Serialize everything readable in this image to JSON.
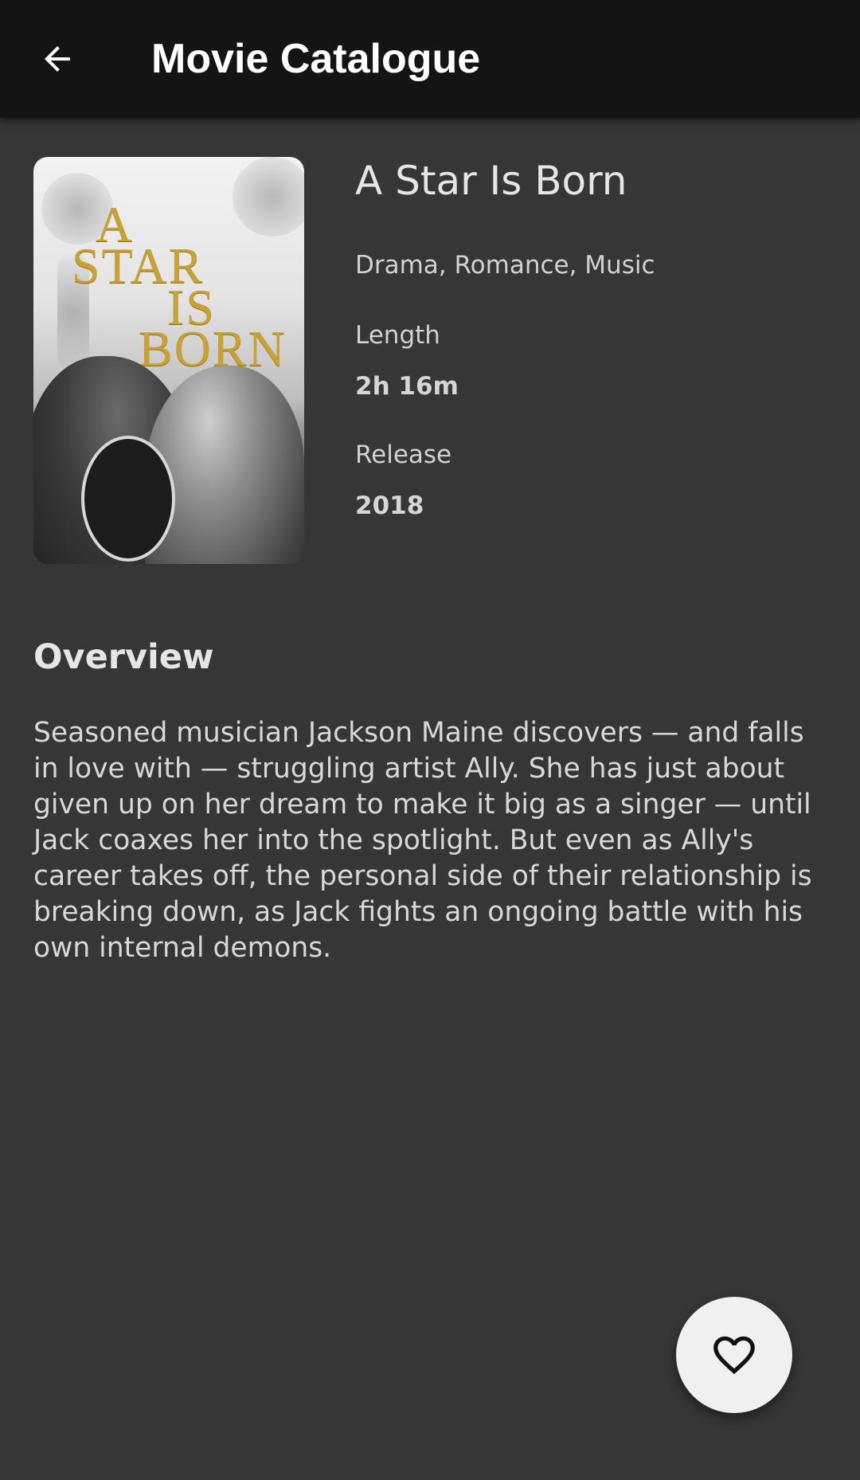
{
  "toolbar": {
    "title": "Movie Catalogue",
    "back_icon": "arrow-back-icon"
  },
  "movie": {
    "poster_icon": "movie-poster-image",
    "poster_text": [
      "A",
      "STAR",
      "IS",
      "BORN"
    ],
    "title": "A Star Is Born",
    "genres": "Drama, Romance, Music",
    "length_label": "Length",
    "length_value": "2h 16m",
    "release_label": "Release",
    "release_value": "2018"
  },
  "overview": {
    "heading": "Overview",
    "text": "Seasoned musician Jackson Maine discovers — and falls in love with — struggling artist Ally. She has just about given up on her dream to make it big as a singer — until Jack coaxes her into the spotlight. But even as Ally's career takes off, the personal side of their relationship is breaking down, as Jack fights an ongoing battle with his own internal demons."
  },
  "fab": {
    "icon": "heart-outline-icon"
  },
  "colors": {
    "background": "#363636",
    "toolbar": "#141414",
    "fab": "#f0f0f0",
    "poster_gold": "#c9a235"
  }
}
